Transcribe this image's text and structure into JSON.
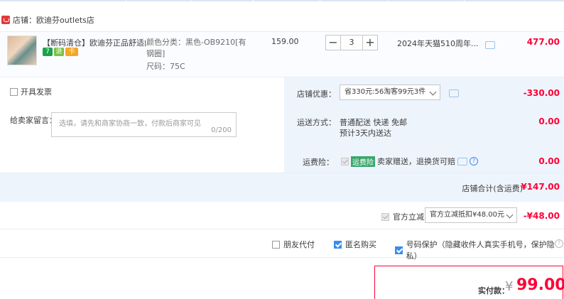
{
  "shop": {
    "label": "店铺：欧迪芬outlets店"
  },
  "item": {
    "title": "【断码清仓】欧迪芬正品舒适内...",
    "attr_color": "颜色分类：黑色-OB9210[有钢圈]",
    "attr_size": "尺码：75C",
    "unit_price": "159.00",
    "quantity": "3",
    "minus": "−",
    "plus": "+",
    "promo": "2024年天猫510周年...",
    "subtotal": "477.00",
    "badges": [
      "7",
      "退",
      "卡"
    ]
  },
  "invoice": {
    "label": "开具发票",
    "checked": false
  },
  "message": {
    "label": "给卖家留言：",
    "placeholder": "选填，请先和商家协商一致，付款后商家可见",
    "counter": "0/200"
  },
  "shop_discount": {
    "label": "店铺优惠：",
    "selected": "省330元:56淘客99元3件",
    "amount": "-330.00"
  },
  "shipping": {
    "label": "运送方式：",
    "method": "普通配送 快递 免邮",
    "eta": "预计3天内送达",
    "amount": "0.00"
  },
  "insurance": {
    "label": "运费险：",
    "tag": "运费险",
    "text": "卖家赠送，退换货可赔",
    "amount": "0.00",
    "help": "?"
  },
  "shop_total": {
    "label": "店铺合计(含运费)",
    "amount": "¥147.00"
  },
  "official": {
    "label": "官方立减",
    "selected": "官方立减抵扣¥48.00元",
    "amount": "-¥48.00"
  },
  "options": {
    "friend_pay": {
      "label": "朋友代付",
      "checked": false
    },
    "anonymous": {
      "label": "匿名购买",
      "checked": true
    },
    "phone_protect": {
      "label": "号码保护（隐藏收件人真实手机号，保护隐私）",
      "checked": true
    }
  },
  "payment": {
    "label": "实付款：",
    "currency": "¥",
    "amount": "99.00"
  },
  "colors": {
    "accent": "#ff0036",
    "blue": "#3a8cf0",
    "panel": "#eef4fc"
  }
}
